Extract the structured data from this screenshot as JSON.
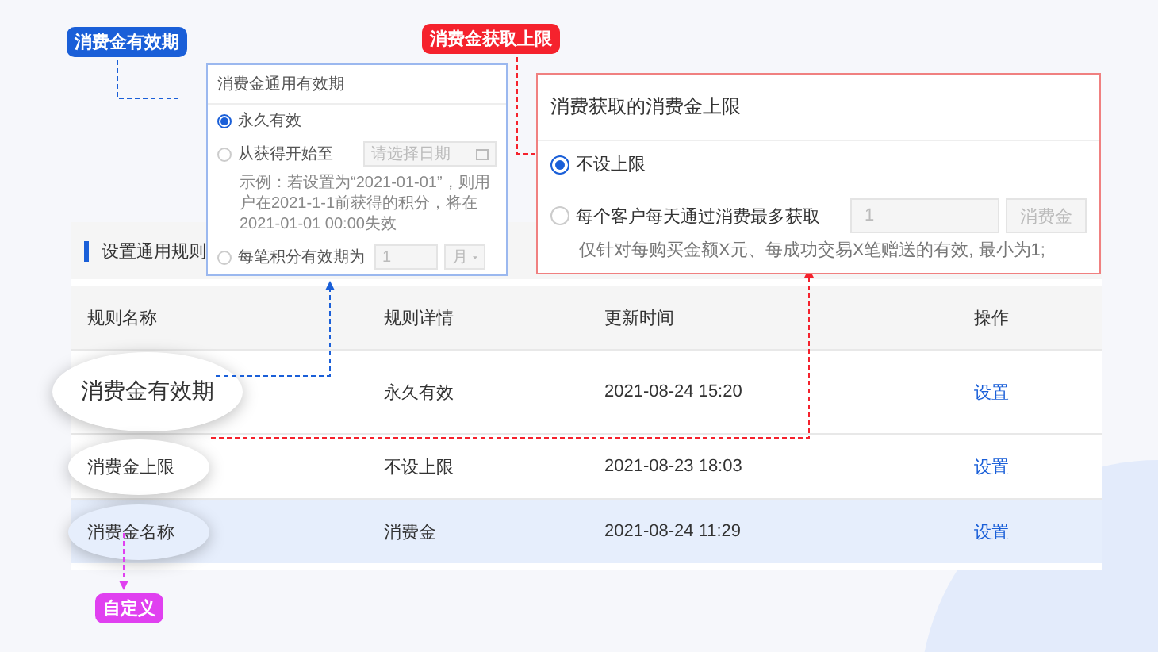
{
  "annotations": [
    {
      "label": "消费金有效期",
      "color": "#1a5fd8"
    },
    {
      "label": "消费金获取上限",
      "color": "#f5222d"
    },
    {
      "label": "自定义",
      "color": "#e040f0"
    }
  ],
  "validity_popup": {
    "title": "消费金通用有效期",
    "options": [
      {
        "kind": "plain",
        "label": "永久有效",
        "selected": true
      },
      {
        "kind": "date",
        "label": "从获得开始至",
        "selected": false,
        "placeholder": "请选择日期",
        "hint": "示例：若设置为“2021-01-01”，则用户在2021-1-1前获得的积分，将在2021-01-01 00:00失效"
      },
      {
        "kind": "period",
        "label": "每笔积分有效期为",
        "selected": false,
        "value": "1",
        "unit": "月"
      }
    ]
  },
  "limit_popup": {
    "title": "消费获取的消费金上限",
    "options": [
      {
        "kind": "plain",
        "label": "不设上限",
        "selected": true
      },
      {
        "kind": "amount",
        "label": "每个客户每天通过消费最多获取",
        "selected": false,
        "value": "1",
        "unit": "消费金",
        "hint": "仅针对每购买金额X元、每成功交易X笔赠送的有效, 最小为1;"
      }
    ]
  },
  "section_title": "设置通用规则",
  "table": {
    "columns": [
      "规则名称",
      "规则详情",
      "更新时间",
      "操作"
    ],
    "rows": [
      {
        "name": "消费金有效期",
        "detail": "永久有效",
        "time": "2021-08-24 15:20",
        "action": "设置",
        "selected": false,
        "magnified": true
      },
      {
        "name": "消费金上限",
        "detail": "不设上限",
        "time": "2021-08-23 18:03",
        "action": "设置",
        "selected": false,
        "magnified": false
      },
      {
        "name": "消费金名称",
        "detail": "消费金",
        "time": "2021-08-24 11:29",
        "action": "设置",
        "selected": true,
        "magnified": false
      }
    ]
  }
}
